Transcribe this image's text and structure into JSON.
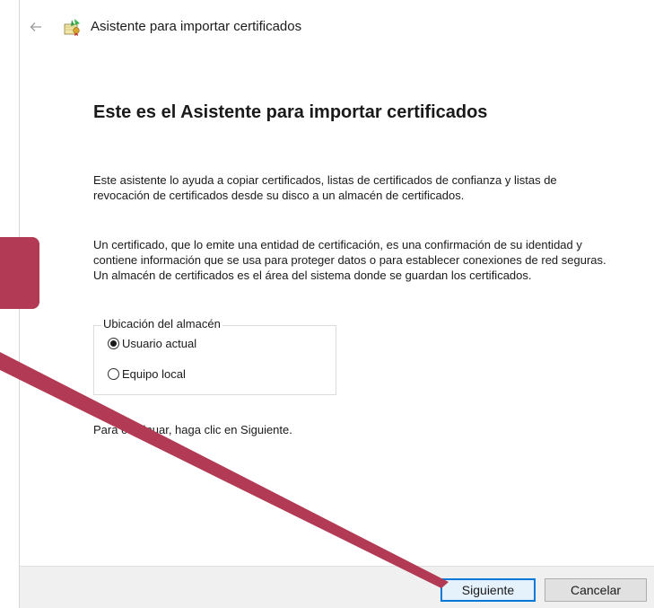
{
  "window": {
    "title": "Asistente para importar certificados",
    "back_icon": "back-arrow-icon",
    "app_icon": "certificate-wizard-icon"
  },
  "main": {
    "heading": "Este es el Asistente para importar certificados",
    "paragraph_1": "Este asistente lo ayuda a copiar certificados, listas de certificados de confianza y listas de revocación de certificados desde su disco a un almacén de certificados.",
    "paragraph_2": "Un certificado, que lo emite una entidad de certificación, es una confirmación de su identidad y contiene información que se usa para proteger datos o para establecer conexiones de red seguras. Un almacén de certificados es el área del sistema donde se guardan los certificados.",
    "store_location": {
      "legend": "Ubicación del almacén",
      "options": [
        {
          "label": "Usuario actual",
          "checked": true
        },
        {
          "label": "Equipo local",
          "checked": false
        }
      ]
    },
    "paragraph_3": "Para continuar, haga clic en Siguiente."
  },
  "footer": {
    "next_label": "Siguiente",
    "cancel_label": "Cancelar"
  },
  "annotation": {
    "color": "#b23a55"
  }
}
